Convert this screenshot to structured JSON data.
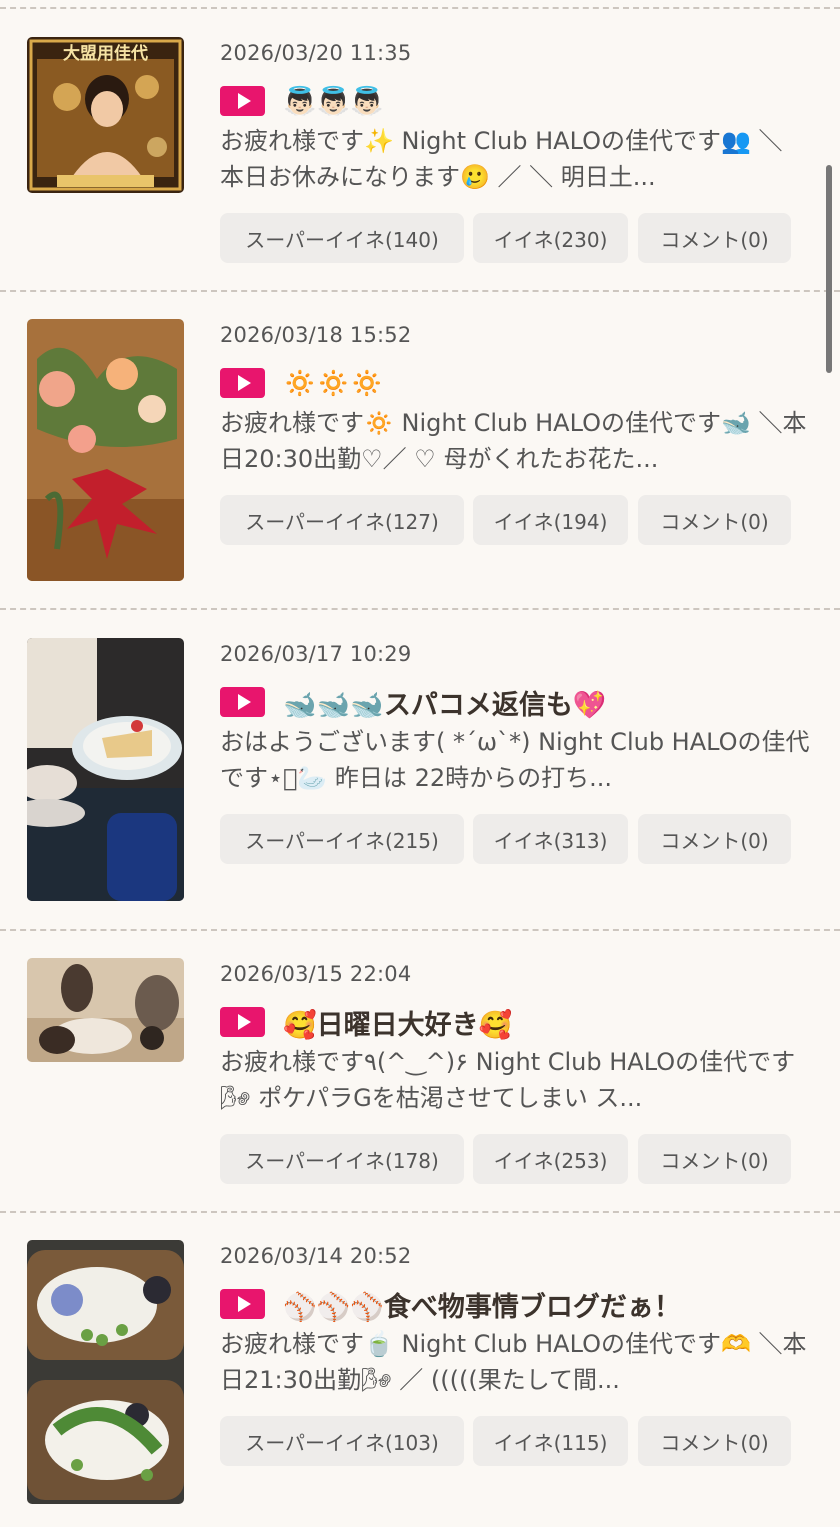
{
  "posts": [
    {
      "date": "2026/03/20 11:35",
      "title": "👼🏻👼🏻👼🏻",
      "excerpt": "お疲れ様です✨ Night Club HALOの佳代です👥 ＼ 本日お休みになります🥲 ／ ＼ 明日土...",
      "super_like": "スーパーイイネ(140)",
      "like": "イイネ(230)",
      "comment": "コメント(0)",
      "thumb_text": "大盟用佳代"
    },
    {
      "date": "2026/03/18 15:52",
      "title": "🔅🔅🔅",
      "excerpt": "お疲れ様です🔅 Night Club HALOの佳代です🐋 ＼本日20:30出勤♡／ ♡ 母がくれたお花た...",
      "super_like": "スーパーイイネ(127)",
      "like": "イイネ(194)",
      "comment": "コメント(0)"
    },
    {
      "date": "2026/03/17 10:29",
      "title": "🐋🐋🐋スパコメ返信も💖",
      "excerpt": "おはようございます( *´ω`*) Night Club HALOの佳代です⋆͛🦢 昨日は 22時からの打ち...",
      "super_like": "スーパーイイネ(215)",
      "like": "イイネ(313)",
      "comment": "コメント(0)"
    },
    {
      "date": "2026/03/15 22:04",
      "title": "🥰日曜日大好き🥰",
      "excerpt": "お疲れ様です٩(^‿^)۶ Night Club HALOの佳代です🌬 ポケパラGを枯渇させてしまい ス...",
      "super_like": "スーパーイイネ(178)",
      "like": "イイネ(253)",
      "comment": "コメント(0)"
    },
    {
      "date": "2026/03/14 20:52",
      "title": "⚾⚾⚾食べ物事情ブログだぁ！",
      "excerpt": "お疲れ様です🍵 Night Club HALOの佳代です🫶 ＼本日21:30出勤🌬 ／ (((((果たして間...",
      "super_like": "スーパーイイネ(103)",
      "like": "イイネ(115)",
      "comment": "コメント(0)"
    }
  ],
  "colors": {
    "background": "#fbf8f4",
    "play_button": "#e8156d",
    "button_bg": "#eeecea"
  }
}
